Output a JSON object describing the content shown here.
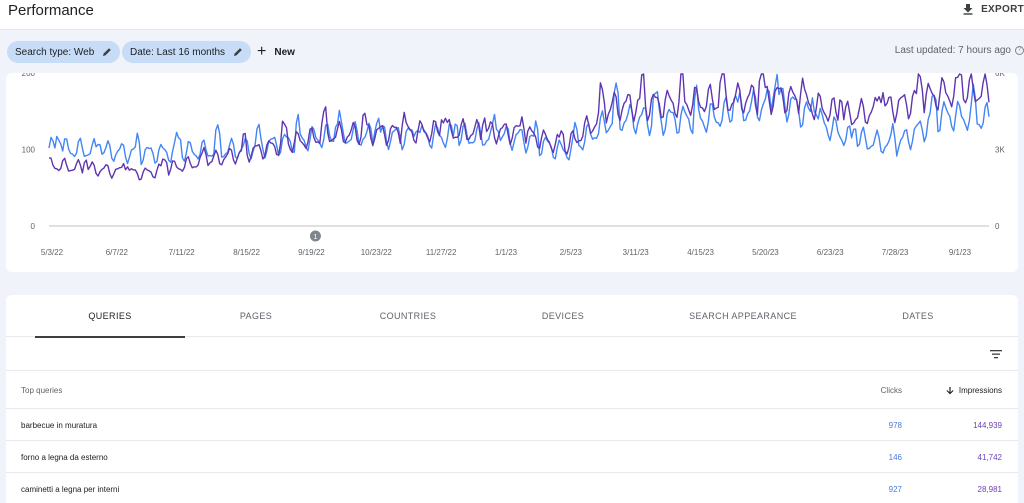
{
  "header": {
    "title": "Performance",
    "export_label": "EXPORT"
  },
  "filters": {
    "search_type": "Search type: Web",
    "date": "Date: Last 16 months",
    "new_label": "New",
    "last_updated": "Last updated: 7 hours ago"
  },
  "chart_data": {
    "type": "line",
    "x_ticks": [
      "5/3/22",
      "6/7/22",
      "7/11/22",
      "8/15/22",
      "9/19/22",
      "10/23/22",
      "11/27/22",
      "1/1/23",
      "2/5/23",
      "3/11/23",
      "4/15/23",
      "5/20/23",
      "6/23/23",
      "7/28/23",
      "9/1/23"
    ],
    "y_left_ticks": [
      "0",
      "100",
      "200"
    ],
    "y_left_range": [
      0,
      200
    ],
    "y_right_ticks": [
      "0",
      "3K",
      "6K"
    ],
    "y_right_range": [
      0,
      6000
    ],
    "annotation": {
      "label": "1",
      "x": "9/19/22"
    },
    "series": [
      {
        "axis": "left",
        "color": "#4285f4",
        "trend": [
          [
            0,
            102
          ],
          [
            0.1,
            95
          ],
          [
            0.2,
            100
          ],
          [
            0.3,
            118
          ],
          [
            0.4,
            118
          ],
          [
            0.5,
            116
          ],
          [
            0.55,
            97
          ],
          [
            0.6,
            140
          ],
          [
            0.7,
            140
          ],
          [
            0.78,
            165
          ],
          [
            0.85,
            115
          ],
          [
            0.9,
            105
          ],
          [
            0.95,
            145
          ],
          [
            1,
            140
          ]
        ]
      },
      {
        "axis": "right",
        "color": "#5e35b1",
        "trend": [
          [
            0,
            2400
          ],
          [
            0.1,
            2050
          ],
          [
            0.2,
            2800
          ],
          [
            0.3,
            3600
          ],
          [
            0.4,
            3700
          ],
          [
            0.5,
            3700
          ],
          [
            0.55,
            3100
          ],
          [
            0.6,
            4700
          ],
          [
            0.7,
            4900
          ],
          [
            0.78,
            5100
          ],
          [
            0.85,
            4300
          ],
          [
            0.9,
            4700
          ],
          [
            0.95,
            5200
          ],
          [
            1,
            5300
          ]
        ]
      }
    ]
  },
  "tabs": [
    "QUERIES",
    "PAGES",
    "COUNTRIES",
    "DEVICES",
    "SEARCH APPEARANCE",
    "DATES"
  ],
  "table": {
    "col_query": "Top queries",
    "col_clicks": "Clicks",
    "col_impressions": "Impressions",
    "rows": [
      {
        "query": "barbecue in muratura",
        "clicks": "978",
        "impressions": "144,939"
      },
      {
        "query": "forno a legna da esterno",
        "clicks": "146",
        "impressions": "41,742"
      },
      {
        "query": "caminetti a legna per interni",
        "clicks": "927",
        "impressions": "28,981"
      }
    ]
  }
}
